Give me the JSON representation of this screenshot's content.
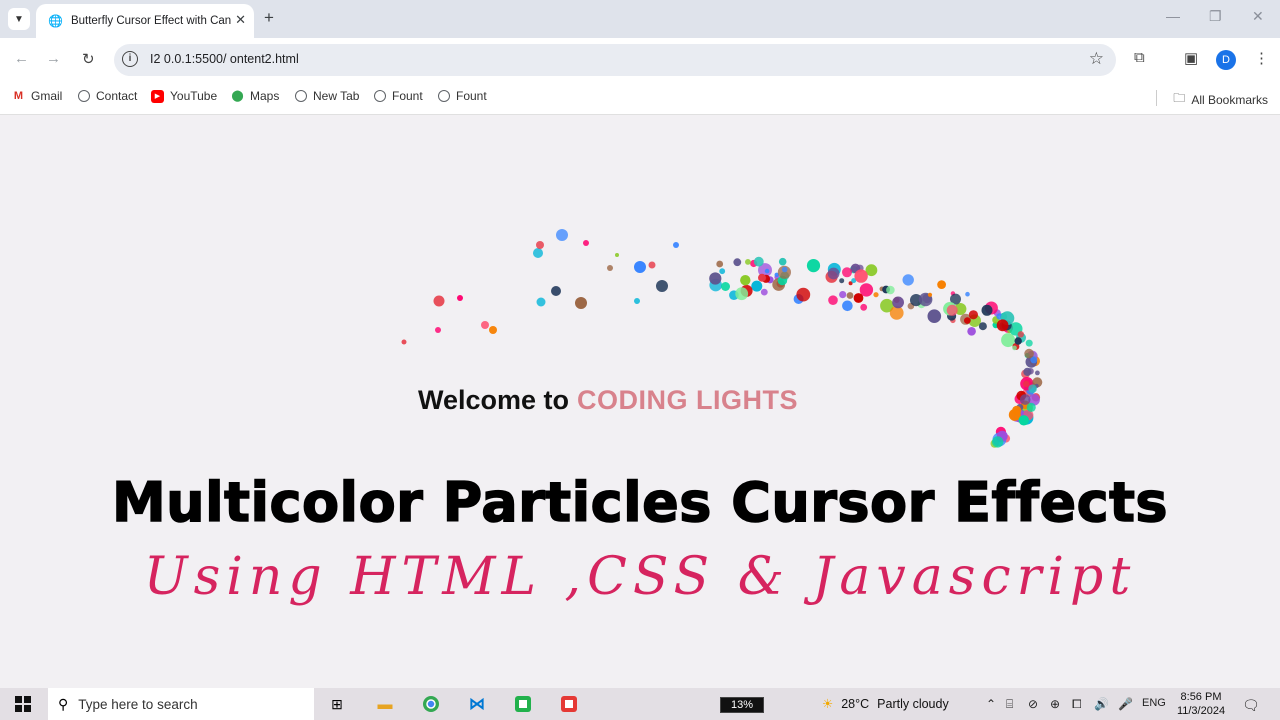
{
  "browser": {
    "tab_title": "Butterfly Cursor Effect with Can",
    "tab_close": "✕",
    "new_tab": "+",
    "url": "I2 0.0.1:5500/ ontent2.html",
    "info_icon": "info-icon",
    "avatar_letter": "D"
  },
  "bookmarks": {
    "items": [
      {
        "label": "Gmail",
        "icon": "gmail-icon"
      },
      {
        "label": "Contact",
        "icon": "globe-icon"
      },
      {
        "label": "YouTube",
        "icon": "youtube-icon"
      },
      {
        "label": "Maps",
        "icon": "maps-icon"
      },
      {
        "label": "New Tab",
        "icon": "globe-icon"
      },
      {
        "label": "Fount",
        "icon": "globe-icon"
      },
      {
        "label": "Fount",
        "icon": "globe-icon"
      }
    ],
    "all_bookmarks": "All Bookmarks"
  },
  "page": {
    "welcome_prefix": "Welcome to",
    "welcome_highlight": "CODING LIGHTS",
    "headline": "Multicolor Particles Cursor Effects",
    "subline": "Using HTML ,CSS & Javascript",
    "colors": {
      "highlight": "#d8828c",
      "subline": "#d6245f",
      "particles": [
        "#9d4edd",
        "#ff006e",
        "#3a86ff",
        "#06d6a0",
        "#f77f00",
        "#2ec4b6",
        "#8ac926",
        "#e63946",
        "#1d3557",
        "#ff4d6d",
        "#00b4d8",
        "#6a4c93",
        "#d00000",
        "#80ed99",
        "#5e548e",
        "#9c6644"
      ]
    }
  },
  "taskbar": {
    "search_placeholder": "Type here to search",
    "battery": "13%",
    "temperature": "28°C",
    "weather": "Partly cloudy",
    "language": "ENG",
    "time": "8:56 PM",
    "date": "11/3/2024"
  }
}
